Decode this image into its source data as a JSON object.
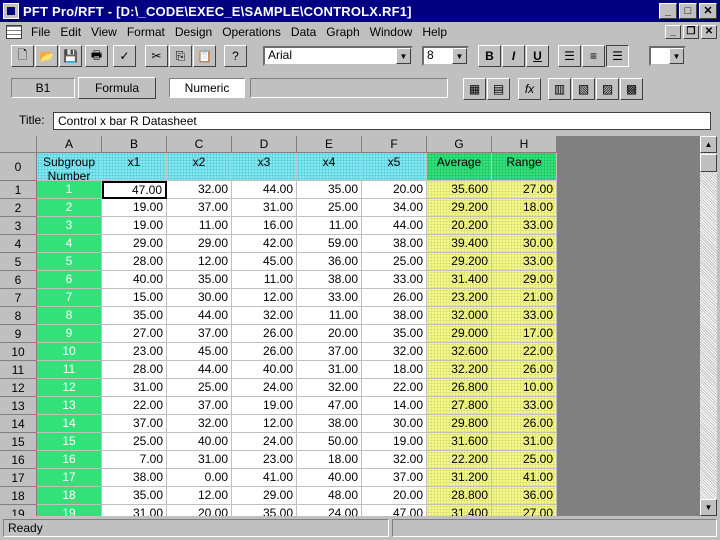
{
  "window": {
    "title": "PFT Pro/RFT - [D:\\_CODE\\EXEC_E\\SAMPLE\\CONTROLX.RF1]"
  },
  "menu": [
    "File",
    "Edit",
    "View",
    "Format",
    "Design",
    "Operations",
    "Data",
    "Graph",
    "Window",
    "Help"
  ],
  "toolbar": {
    "font": "Arial",
    "size": "8",
    "bold": "B",
    "italic": "I",
    "underline": "U"
  },
  "formula_bar": {
    "cell_ref": "B1",
    "formula_label": "Formula",
    "type": "Numeric"
  },
  "sheet": {
    "title_label": "Title:",
    "title_value": "Control x bar R Datasheet",
    "columns": [
      "A",
      "B",
      "C",
      "D",
      "E",
      "F",
      "G",
      "H"
    ],
    "headers": [
      "Subgroup Number",
      "x1",
      "x2",
      "x3",
      "x4",
      "x5",
      "Average",
      "Range"
    ],
    "rows": [
      [
        "1",
        "47.00",
        "32.00",
        "44.00",
        "35.00",
        "20.00",
        "35.600",
        "27.00"
      ],
      [
        "2",
        "19.00",
        "37.00",
        "31.00",
        "25.00",
        "34.00",
        "29.200",
        "18.00"
      ],
      [
        "3",
        "19.00",
        "11.00",
        "16.00",
        "11.00",
        "44.00",
        "20.200",
        "33.00"
      ],
      [
        "4",
        "29.00",
        "29.00",
        "42.00",
        "59.00",
        "38.00",
        "39.400",
        "30.00"
      ],
      [
        "5",
        "28.00",
        "12.00",
        "45.00",
        "36.00",
        "25.00",
        "29.200",
        "33.00"
      ],
      [
        "6",
        "40.00",
        "35.00",
        "11.00",
        "38.00",
        "33.00",
        "31.400",
        "29.00"
      ],
      [
        "7",
        "15.00",
        "30.00",
        "12.00",
        "33.00",
        "26.00",
        "23.200",
        "21.00"
      ],
      [
        "8",
        "35.00",
        "44.00",
        "32.00",
        "11.00",
        "38.00",
        "32.000",
        "33.00"
      ],
      [
        "9",
        "27.00",
        "37.00",
        "26.00",
        "20.00",
        "35.00",
        "29.000",
        "17.00"
      ],
      [
        "10",
        "23.00",
        "45.00",
        "26.00",
        "37.00",
        "32.00",
        "32.600",
        "22.00"
      ],
      [
        "11",
        "28.00",
        "44.00",
        "40.00",
        "31.00",
        "18.00",
        "32.200",
        "26.00"
      ],
      [
        "12",
        "31.00",
        "25.00",
        "24.00",
        "32.00",
        "22.00",
        "26.800",
        "10.00"
      ],
      [
        "13",
        "22.00",
        "37.00",
        "19.00",
        "47.00",
        "14.00",
        "27.800",
        "33.00"
      ],
      [
        "14",
        "37.00",
        "32.00",
        "12.00",
        "38.00",
        "30.00",
        "29.800",
        "26.00"
      ],
      [
        "15",
        "25.00",
        "40.00",
        "24.00",
        "50.00",
        "19.00",
        "31.600",
        "31.00"
      ],
      [
        "16",
        "7.00",
        "31.00",
        "23.00",
        "18.00",
        "32.00",
        "22.200",
        "25.00"
      ],
      [
        "17",
        "38.00",
        "0.00",
        "41.00",
        "40.00",
        "37.00",
        "31.200",
        "41.00"
      ],
      [
        "18",
        "35.00",
        "12.00",
        "29.00",
        "48.00",
        "20.00",
        "28.800",
        "36.00"
      ],
      [
        "19",
        "31.00",
        "20.00",
        "35.00",
        "24.00",
        "47.00",
        "31.400",
        "27.00"
      ]
    ]
  },
  "status": {
    "text": "Ready"
  },
  "colors": {
    "title_bg": "#000080",
    "subgroup_green": "#33e07a",
    "avg_yellow": "#f4f88a",
    "header_cyan": "#7fe8f0"
  }
}
